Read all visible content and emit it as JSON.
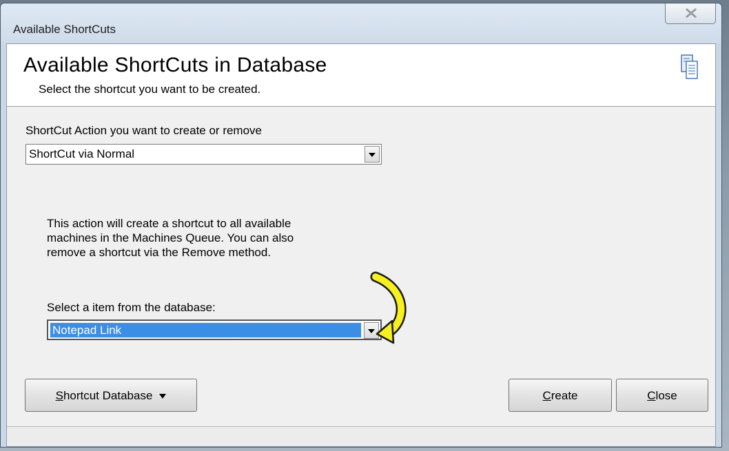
{
  "window": {
    "title": "Available ShortCuts"
  },
  "banner": {
    "title": "Available ShortCuts in Database",
    "subtitle": "Select the shortcut you want to be created.",
    "icon": "document-copy-icon"
  },
  "action": {
    "label": "ShortCut Action you want to create or remove",
    "selected": "ShortCut via Normal"
  },
  "description": {
    "lines": [
      "This action will create a shortcut to all available",
      "machines in the Machines Queue. You can also",
      "remove a shortcut via the Remove method."
    ]
  },
  "item": {
    "label": "Select a item from the database:",
    "selected": "Notepad Link"
  },
  "buttons": {
    "shortcut_db_first": "S",
    "shortcut_db_rest": "hortcut Database",
    "create_first": "C",
    "create_rest": "reate",
    "close_first": "C",
    "close_rest": "lose"
  },
  "colors": {
    "selection": "#3a8ee6",
    "annotation_arrow": "#f5f01e"
  }
}
